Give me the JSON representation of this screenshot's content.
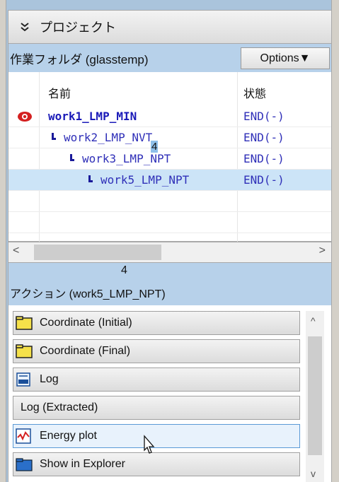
{
  "project": {
    "title": "プロジェクト",
    "collapse_icon": "double-chevron-up-icon"
  },
  "folder": {
    "label": "作業フォルダ (glasstemp)",
    "options_label": "Options▼"
  },
  "tree": {
    "headers": {
      "name": "名前",
      "status": "状態"
    },
    "rows": [
      {
        "name": "work1_LMP_MIN",
        "status": "END(-)",
        "icon": "eye-icon",
        "selected": false,
        "bold": true
      },
      {
        "name": "work2_LMP_NVT",
        "status": "END(-)",
        "icon": "child-node-icon",
        "selected": false,
        "bold": false
      },
      {
        "name": "work3_LMP_NPT",
        "status": "END(-)",
        "icon": "child-node-icon",
        "selected": false,
        "bold": false
      },
      {
        "name": "work5_LMP_NPT",
        "status": "END(-)",
        "icon": "child-node-icon",
        "selected": true,
        "bold": false
      }
    ],
    "overlay_tag": "4"
  },
  "hscroll": {
    "left_arrow": "<",
    "right_arrow": ">"
  },
  "actions": {
    "label": "アクション (work5_LMP_NPT)",
    "badge": "4",
    "buttons": [
      {
        "label": "Coordinate (Initial)",
        "icon": "folder-icon"
      },
      {
        "label": "Coordinate (Final)",
        "icon": "folder-icon"
      },
      {
        "label": "Log",
        "icon": "log-file-icon"
      },
      {
        "label": "Log (Extracted)",
        "icon": ""
      },
      {
        "label": "Energy plot",
        "icon": "chart-line-icon"
      },
      {
        "label": "Show in Explorer",
        "icon": "explorer-folder-icon"
      }
    ],
    "scroll_up": "^",
    "scroll_down": "v"
  },
  "colors": {
    "accent": "#b7d1ea",
    "selection": "#cce4f7",
    "link_text": "#2f2fb8",
    "eye_red": "#d42020"
  }
}
